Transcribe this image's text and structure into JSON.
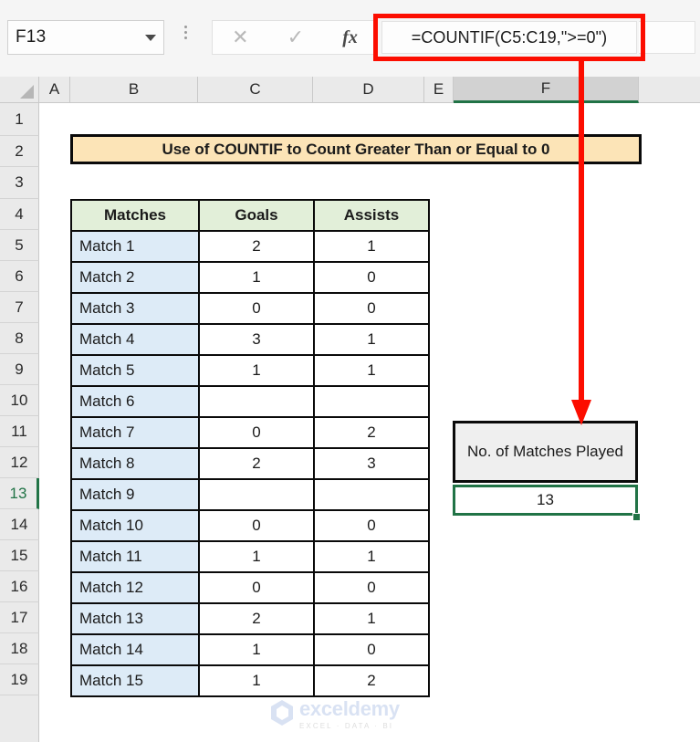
{
  "app": {
    "name_box_value": "F13",
    "formula_value": "=COUNTIF(C5:C19,\">=0\")",
    "cancel_icon": "close-icon",
    "confirm_icon": "check-icon",
    "function_icon": "fx",
    "accent_green": "#217346",
    "annotation_red": "#fc0d00"
  },
  "grid": {
    "columns": [
      "A",
      "B",
      "C",
      "D",
      "E",
      "F"
    ],
    "active_column": "F",
    "rows": [
      "1",
      "2",
      "3",
      "4",
      "5",
      "6",
      "7",
      "8",
      "9",
      "10",
      "11",
      "12",
      "13",
      "14",
      "15",
      "16",
      "17",
      "18",
      "19"
    ],
    "active_row": "13"
  },
  "sheet": {
    "title_banner": "Use of COUNTIF to Count Greater Than or Equal to 0",
    "table": {
      "headers": [
        "Matches",
        "Goals",
        "Assists"
      ],
      "rows": [
        [
          "Match 1",
          "2",
          "1"
        ],
        [
          "Match 2",
          "1",
          "0"
        ],
        [
          "Match 3",
          "0",
          "0"
        ],
        [
          "Match 4",
          "3",
          "1"
        ],
        [
          "Match 5",
          "1",
          "1"
        ],
        [
          "Match 6",
          "",
          ""
        ],
        [
          "Match 7",
          "0",
          "2"
        ],
        [
          "Match 8",
          "2",
          "3"
        ],
        [
          "Match 9",
          "",
          ""
        ],
        [
          "Match 10",
          "0",
          "0"
        ],
        [
          "Match 11",
          "1",
          "1"
        ],
        [
          "Match 12",
          "0",
          "0"
        ],
        [
          "Match 13",
          "2",
          "1"
        ],
        [
          "Match 14",
          "1",
          "0"
        ],
        [
          "Match 15",
          "1",
          "2"
        ]
      ]
    },
    "result": {
      "label": "No. of Matches Played",
      "value": "13"
    }
  },
  "watermark": {
    "name": "exceldemy",
    "tagline": "EXCEL · DATA · BI",
    "logo_icon": "hexagon-logo-icon"
  }
}
